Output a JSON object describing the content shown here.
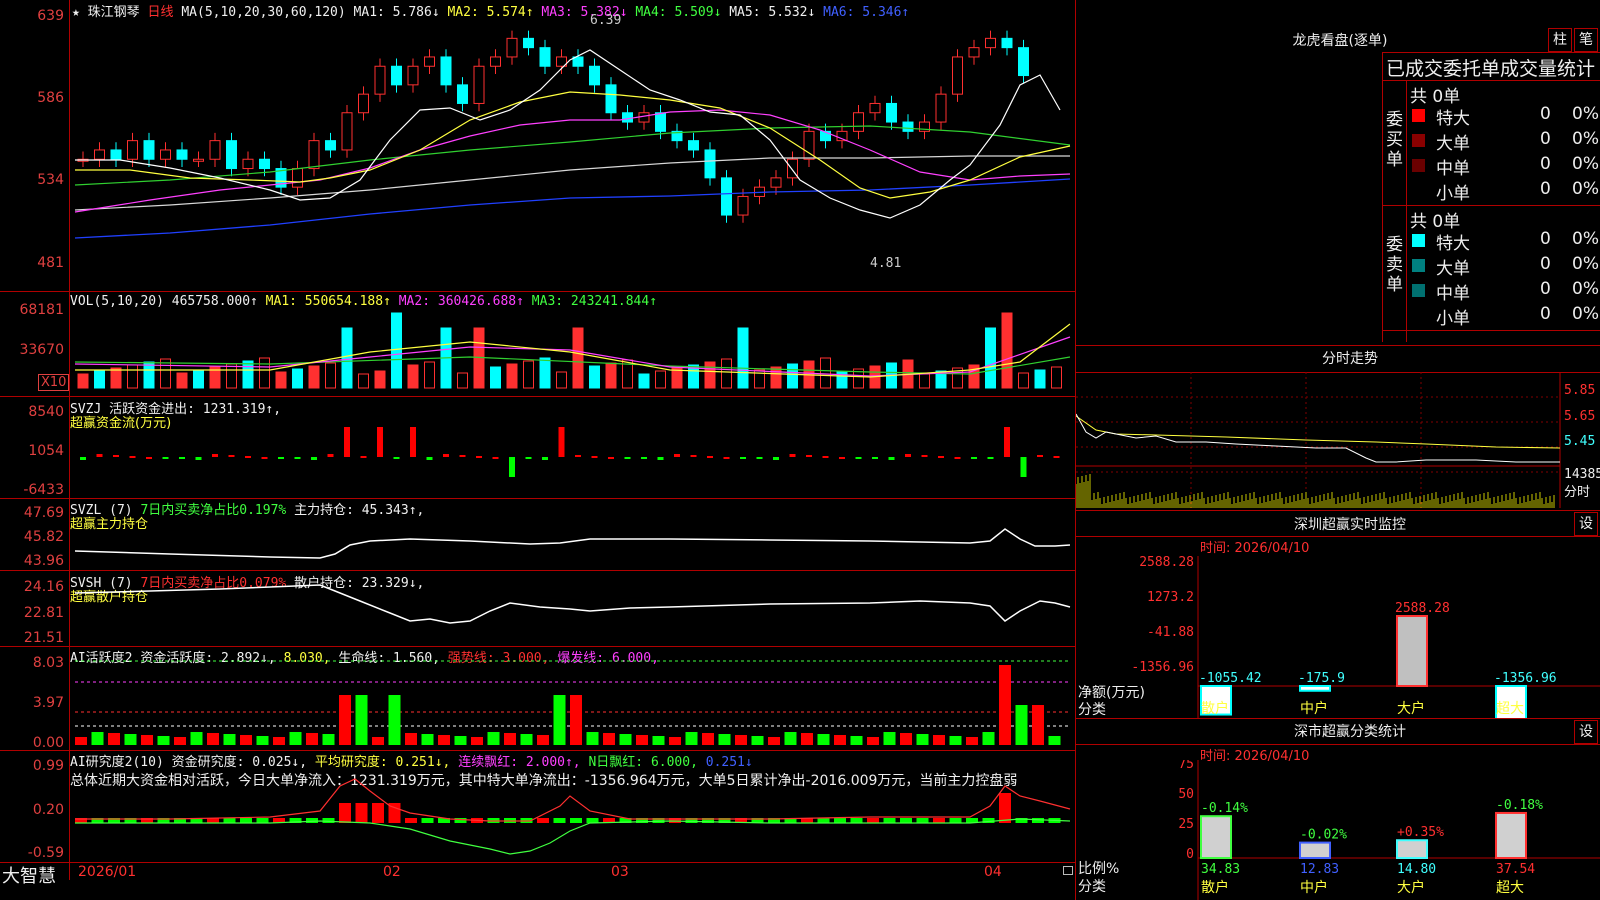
{
  "header": {
    "star": "★",
    "stock_name": "珠江钢琴",
    "period": "日线",
    "ma_label": "MA(5,10,20,30,60,120)",
    "ma1": "MA1: 5.786↓",
    "ma2": "MA2: 5.574↑",
    "ma3": "MA3: 5.382↓",
    "ma4": "MA4: 5.509↓",
    "ma5": "MA5: 5.532↓",
    "ma6": "MA6: 5.346↑"
  },
  "price_axis": [
    "639",
    "586",
    "534",
    "481"
  ],
  "price_annotations": {
    "high": "6.39",
    "low": "4.81"
  },
  "volume": {
    "label": "VOL(5,10,20)",
    "value": "465758.000↑",
    "ma1": "MA1: 550654.188↑",
    "ma2": "MA2: 360426.688↑",
    "ma3": "MA3: 243241.844↑",
    "axis": [
      "68181",
      "33670"
    ],
    "unit": "X10"
  },
  "svzj": {
    "label": "SVZJ",
    "text": "活跃资金进出: 1231.319↑,",
    "subtitle": "超赢资金流(万元)",
    "axis": [
      "8540",
      "1054",
      "-6433"
    ]
  },
  "svzl": {
    "label": "SVZL (7)",
    "ratio": "7日内买卖净占比0.197%",
    "hold": "主力持仓: 45.343↑,",
    "subtitle": "超赢主力持仓",
    "axis": [
      "47.69",
      "45.82",
      "43.96"
    ]
  },
  "svsh": {
    "label": "SVSH (7)",
    "ratio": "7日内买卖净占比0.079%",
    "hold": "散户持仓: 23.329↓,",
    "subtitle": "超赢散户持仓",
    "axis": [
      "24.16",
      "22.81",
      "21.51"
    ]
  },
  "ai_active": {
    "label": "AI活跃度2",
    "activity": "资金活跃度: 2.892↓,",
    "v2": "8.030,",
    "life": "生命线: 1.560,",
    "strong": "强势线: 3.000,",
    "burst": "爆发线: 6.000,",
    "axis": [
      "8.03",
      "3.97",
      "0.00"
    ]
  },
  "ai_research": {
    "label": "AI研究度2(10)",
    "research": "资金研究度: 0.025↓,",
    "avg": "平均研究度: 0.251↓,",
    "consec": "连续飘红: 2.000↑,",
    "nday": "N日飘红: 6.000,",
    "last": "0.251↓",
    "summary": "总体近期大资金相对活跃，今日大单净流入：1231.319万元，其中特大单净流出：-1356.964万元，大单5日累计净出-2016.009万元，当前主力控盘弱",
    "axis": [
      "0.99",
      "0.20",
      "-0.59"
    ]
  },
  "date_axis": [
    "2026/01",
    "02",
    "03",
    "04"
  ],
  "footer_brand": "大智慧",
  "longhu": {
    "title": "龙虎看盘(逐单)",
    "btn1": "柱",
    "btn2": "笔",
    "subtitle": "已成交委托单成交量统计",
    "buy_label": "委买单",
    "sell_label": "委卖单",
    "buy_total": "共 0单",
    "sell_total": "共 0单",
    "rows": [
      {
        "name": "特大",
        "count": "0",
        "pct": "0%"
      },
      {
        "name": "大单",
        "count": "0",
        "pct": "0%"
      },
      {
        "name": "中单",
        "count": "0",
        "pct": "0%"
      },
      {
        "name": "小单",
        "count": "0",
        "pct": "0%"
      }
    ],
    "buy_colors": [
      "#ff0000",
      "#8a0000",
      "#6a0000",
      "#000000"
    ],
    "sell_colors": [
      "#00ffff",
      "#008080",
      "#007070",
      "#000000"
    ]
  },
  "intraday": {
    "title": "分时走势",
    "axis": [
      "5.85",
      "5.65",
      "5.45"
    ],
    "vol_label": "14385",
    "vol_unit": "分时"
  },
  "sz_monitor": {
    "title": "深圳超赢实时监控",
    "btn": "设",
    "time": "时间: 2026/04/10",
    "axis": [
      "2588.28",
      "1273.2",
      "-41.88",
      "-1356.96"
    ],
    "side_label1": "净额(万元)",
    "side_label2": "分类",
    "values": [
      "-1055.42",
      "-175.9",
      "2588.28",
      "-1356.96"
    ],
    "categories": [
      "散户",
      "中户",
      "大户",
      "超大"
    ]
  },
  "sz_stats": {
    "title": "深市超赢分类统计",
    "btn": "设",
    "time": "时间: 2026/04/10",
    "axis": [
      "75",
      "50",
      "25",
      "0"
    ],
    "side_label1": "比例%",
    "side_label2": "分类",
    "changes": [
      "-0.14%",
      "-0.02%",
      "+0.35%",
      "-0.18%"
    ],
    "values": [
      "34.83",
      "12.83",
      "14.80",
      "37.54"
    ],
    "categories": [
      "散户",
      "中户",
      "大户",
      "超大"
    ]
  }
}
